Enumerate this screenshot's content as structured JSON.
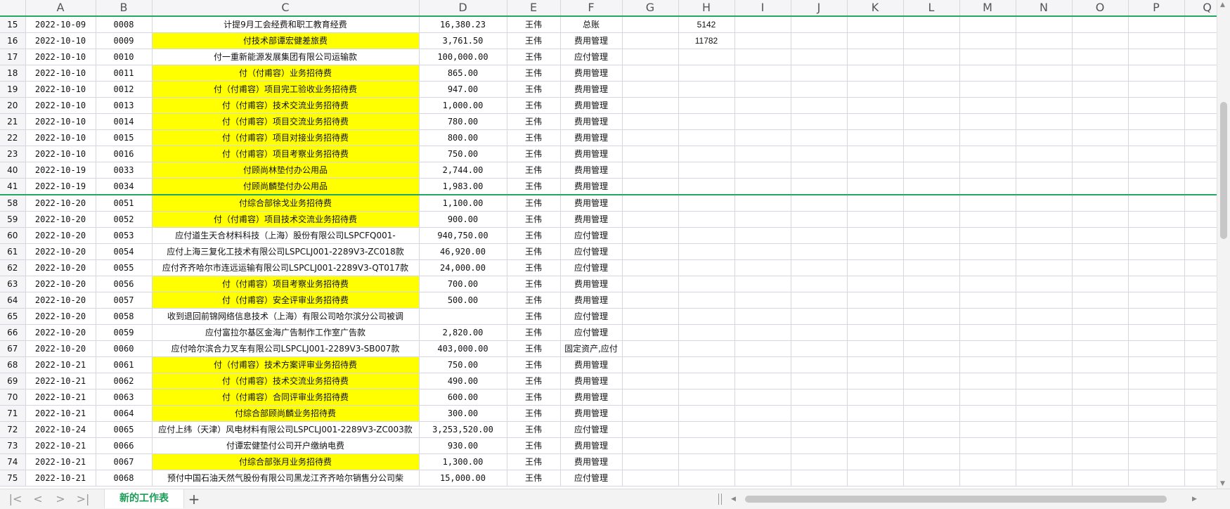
{
  "columns": [
    "A",
    "B",
    "C",
    "D",
    "E",
    "F",
    "G",
    "H",
    "I",
    "J",
    "K",
    "L",
    "M",
    "N",
    "O",
    "P",
    "Q"
  ],
  "h_values": {
    "15": "5142",
    "16": "11782"
  },
  "rows": [
    {
      "n": "15",
      "date": "2022-10-09",
      "no": "0008",
      "desc": "计提9月工会经费和职工教育经费",
      "amt": "16,380.23",
      "person": "王伟",
      "cat": "总账",
      "hl": false,
      "wrap": false
    },
    {
      "n": "16",
      "date": "2022-10-10",
      "no": "0009",
      "desc": "付技术部谭宏健差旅费",
      "amt": "3,761.50",
      "person": "王伟",
      "cat": "费用管理",
      "hl": true,
      "wrap": false
    },
    {
      "n": "17",
      "date": "2022-10-10",
      "no": "0010",
      "desc": "付一重新能源发展集团有限公司运输款",
      "amt": "100,000.00",
      "person": "王伟",
      "cat": "应付管理",
      "hl": false,
      "wrap": false
    },
    {
      "n": "18",
      "date": "2022-10-10",
      "no": "0011",
      "desc": "付（付甫容）业务招待费",
      "amt": "865.00",
      "person": "王伟",
      "cat": "费用管理",
      "hl": true,
      "wrap": false
    },
    {
      "n": "19",
      "date": "2022-10-10",
      "no": "0012",
      "desc": "付（付甫容）项目完工验收业务招待费",
      "amt": "947.00",
      "person": "王伟",
      "cat": "费用管理",
      "hl": true,
      "wrap": false
    },
    {
      "n": "20",
      "date": "2022-10-10",
      "no": "0013",
      "desc": "付（付甫容）技术交流业务招待费",
      "amt": "1,000.00",
      "person": "王伟",
      "cat": "费用管理",
      "hl": true,
      "wrap": false
    },
    {
      "n": "21",
      "date": "2022-10-10",
      "no": "0014",
      "desc": "付（付甫容）项目交流业务招待费",
      "amt": "780.00",
      "person": "王伟",
      "cat": "费用管理",
      "hl": true,
      "wrap": false
    },
    {
      "n": "22",
      "date": "2022-10-10",
      "no": "0015",
      "desc": "付（付甫容）项目对接业务招待费",
      "amt": "800.00",
      "person": "王伟",
      "cat": "费用管理",
      "hl": true,
      "wrap": false
    },
    {
      "n": "23",
      "date": "2022-10-10",
      "no": "0016",
      "desc": "付（付甫容）项目考察业务招待费",
      "amt": "750.00",
      "person": "王伟",
      "cat": "费用管理",
      "hl": true,
      "wrap": false
    },
    {
      "n": "40",
      "date": "2022-10-19",
      "no": "0033",
      "desc": "付顾尚林垫付办公用品",
      "amt": "2,744.00",
      "person": "王伟",
      "cat": "费用管理",
      "hl": true,
      "wrap": false
    },
    {
      "n": "41",
      "date": "2022-10-19",
      "no": "0034",
      "desc": "付顾尚麟垫付办公用品",
      "amt": "1,983.00",
      "person": "王伟",
      "cat": "费用管理",
      "hl": true,
      "wrap": false
    },
    {
      "n": "58",
      "date": "2022-10-20",
      "no": "0051",
      "desc": "付综合部徐戈业务招待费",
      "amt": "1,100.00",
      "person": "王伟",
      "cat": "费用管理",
      "hl": true,
      "wrap": false
    },
    {
      "n": "59",
      "date": "2022-10-20",
      "no": "0052",
      "desc": "付（付甫容）项目技术交流业务招待费",
      "amt": "900.00",
      "person": "王伟",
      "cat": "费用管理",
      "hl": true,
      "wrap": false
    },
    {
      "n": "60",
      "date": "2022-10-20",
      "no": "0053",
      "desc": "应付道生天合材料科技（上海）股份有限公司LSPCFQ001-",
      "amt": "940,750.00",
      "person": "王伟",
      "cat": "应付管理",
      "hl": false,
      "wrap": true
    },
    {
      "n": "61",
      "date": "2022-10-20",
      "no": "0054",
      "desc": "应付上海三复化工技术有限公司LSPCLJ001-2289V3-ZC018款",
      "amt": "46,920.00",
      "person": "王伟",
      "cat": "应付管理",
      "hl": false,
      "wrap": false
    },
    {
      "n": "62",
      "date": "2022-10-20",
      "no": "0055",
      "desc": "应付齐齐哈尔市连远运输有限公司LSPCLJ001-2289V3-QT017款",
      "amt": "24,000.00",
      "person": "王伟",
      "cat": "应付管理",
      "hl": false,
      "wrap": false
    },
    {
      "n": "63",
      "date": "2022-10-20",
      "no": "0056",
      "desc": "付（付甫容）项目考察业务招待费",
      "amt": "700.00",
      "person": "王伟",
      "cat": "费用管理",
      "hl": true,
      "wrap": false
    },
    {
      "n": "64",
      "date": "2022-10-20",
      "no": "0057",
      "desc": "付（付甫容）安全评审业务招待费",
      "amt": "500.00",
      "person": "王伟",
      "cat": "费用管理",
      "hl": true,
      "wrap": false
    },
    {
      "n": "65",
      "date": "2022-10-20",
      "no": "0058",
      "desc": "收到退回前锦网络信息技术（上海）有限公司哈尔滨分公司被调",
      "amt": "",
      "person": "王伟",
      "cat": "应付管理",
      "hl": false,
      "wrap": true
    },
    {
      "n": "66",
      "date": "2022-10-20",
      "no": "0059",
      "desc": "应付富拉尔基区金海广告制作工作室广告款",
      "amt": "2,820.00",
      "person": "王伟",
      "cat": "应付管理",
      "hl": false,
      "wrap": false
    },
    {
      "n": "67",
      "date": "2022-10-20",
      "no": "0060",
      "desc": "应付哈尔滨合力叉车有限公司LSPCLJ001-2289V3-SB007款",
      "amt": "403,000.00",
      "person": "王伟",
      "cat": "固定资产,应付",
      "hl": false,
      "wrap": false
    },
    {
      "n": "68",
      "date": "2022-10-21",
      "no": "0061",
      "desc": "付（付甫容）技术方案评审业务招待费",
      "amt": "750.00",
      "person": "王伟",
      "cat": "费用管理",
      "hl": true,
      "wrap": false
    },
    {
      "n": "69",
      "date": "2022-10-21",
      "no": "0062",
      "desc": "付（付甫容）技术交流业务招待费",
      "amt": "490.00",
      "person": "王伟",
      "cat": "费用管理",
      "hl": true,
      "wrap": false
    },
    {
      "n": "70",
      "date": "2022-10-21",
      "no": "0063",
      "desc": "付（付甫容）合同评审业务招待费",
      "amt": "600.00",
      "person": "王伟",
      "cat": "费用管理",
      "hl": true,
      "wrap": false
    },
    {
      "n": "71",
      "date": "2022-10-21",
      "no": "0064",
      "desc": "付综合部顾尚麟业务招待费",
      "amt": "300.00",
      "person": "王伟",
      "cat": "费用管理",
      "hl": true,
      "wrap": false
    },
    {
      "n": "72",
      "date": "2022-10-24",
      "no": "0065",
      "desc": "应付上纬（天津）风电材料有限公司LSPCLJ001-2289V3-ZC003款",
      "amt": "3,253,520.00",
      "person": "王伟",
      "cat": "应付管理",
      "hl": false,
      "wrap": false
    },
    {
      "n": "73",
      "date": "2022-10-21",
      "no": "0066",
      "desc": "付谭宏健垫付公司开户缴纳电费",
      "amt": "930.00",
      "person": "王伟",
      "cat": "费用管理",
      "hl": false,
      "wrap": false
    },
    {
      "n": "74",
      "date": "2022-10-21",
      "no": "0067",
      "desc": "付综合部张月业务招待费",
      "amt": "1,300.00",
      "person": "王伟",
      "cat": "费用管理",
      "hl": true,
      "wrap": false
    },
    {
      "n": "75",
      "date": "2022-10-21",
      "no": "0068",
      "desc": "预付中国石油天然气股份有限公司黑龙江齐齐哈尔销售分公司柴",
      "amt": "15,000.00",
      "person": "王伟",
      "cat": "应付管理",
      "hl": false,
      "wrap": true
    }
  ],
  "tabbar": {
    "sheet_tab_label": "新的工作表",
    "add_tab_label": "+",
    "nav_first": "|<",
    "nav_prev": "<",
    "nav_next": ">",
    "nav_last": ">|"
  },
  "colors": {
    "highlight": "#ffff00",
    "accent": "#1a9d55",
    "freeze_line": "#22a861"
  }
}
